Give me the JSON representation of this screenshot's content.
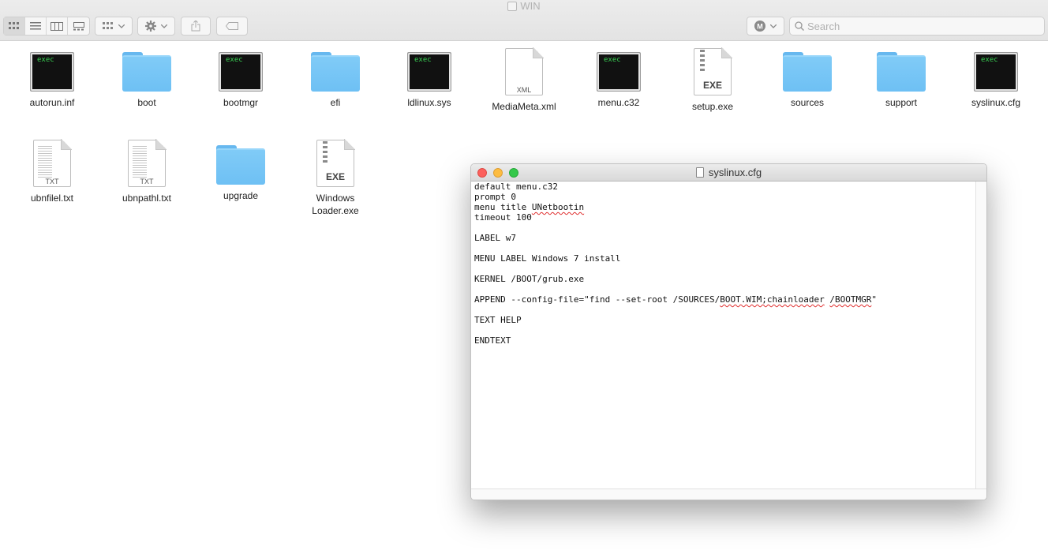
{
  "window": {
    "title": "WIN"
  },
  "toolbar": {
    "view_buttons": [
      "icon-view",
      "list-view",
      "column-view",
      "gallery-view"
    ],
    "search_placeholder": "Search"
  },
  "files": [
    {
      "name": "autorun.inf",
      "kind": "exec",
      "badge": "exec"
    },
    {
      "name": "boot",
      "kind": "folder"
    },
    {
      "name": "bootmgr",
      "kind": "exec",
      "badge": "exec"
    },
    {
      "name": "efi",
      "kind": "folder"
    },
    {
      "name": "ldlinux.sys",
      "kind": "exec",
      "badge": "exec"
    },
    {
      "name": "MediaMeta.xml",
      "kind": "doc",
      "badge": "XML"
    },
    {
      "name": "menu.c32",
      "kind": "exec",
      "badge": "exec"
    },
    {
      "name": "setup.exe",
      "kind": "exe",
      "badge": "EXE"
    },
    {
      "name": "sources",
      "kind": "folder"
    },
    {
      "name": "support",
      "kind": "folder"
    },
    {
      "name": "syslinux.cfg",
      "kind": "exec",
      "badge": "exec"
    },
    {
      "name": "ubnfilel.txt",
      "kind": "txt",
      "badge": "TXT"
    },
    {
      "name": "ubnpathl.txt",
      "kind": "txt",
      "badge": "TXT"
    },
    {
      "name": "upgrade",
      "kind": "folder"
    },
    {
      "name": "Windows Loader.exe",
      "kind": "exe",
      "badge": "EXE"
    }
  ],
  "editor": {
    "title": "syslinux.cfg",
    "lines": [
      "default menu.c32",
      "prompt 0",
      "menu title UNetbootin",
      "timeout 100",
      "",
      "LABEL w7",
      "",
      "MENU LABEL Windows 7 install",
      "",
      "KERNEL /BOOT/grub.exe",
      "",
      "APPEND --config-file=\"find --set-root /SOURCES/BOOT.WIM;chainloader /BOOTMGR\"",
      "",
      "TEXT HELP",
      "",
      "ENDTEXT"
    ]
  }
}
